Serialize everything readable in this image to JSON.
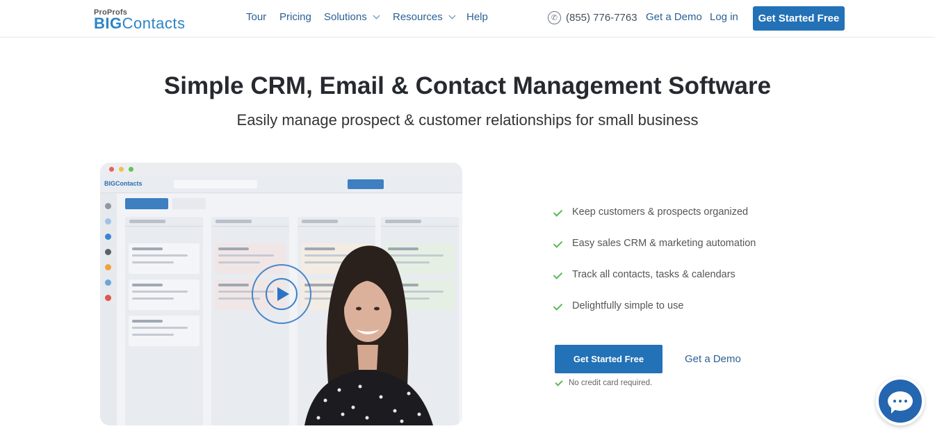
{
  "header": {
    "logo_top": "ProProfs",
    "logo_big": "BIG",
    "logo_rest": "Contacts",
    "nav": {
      "tour": "Tour",
      "pricing": "Pricing",
      "solutions": "Solutions",
      "resources": "Resources",
      "help": "Help"
    },
    "phone": "(855) 776-7763",
    "get_demo": "Get a Demo",
    "login": "Log in",
    "cta": "Get Started Free"
  },
  "hero": {
    "title": "Simple CRM, Email & Contact Management Software",
    "subtitle": "Easily manage prospect & customer relationships for small business"
  },
  "video": {
    "app_logo": "BIGContacts"
  },
  "features": [
    "Keep customers & prospects organized",
    "Easy sales CRM & marketing automation",
    "Track all contacts, tasks & calendars",
    "Delightfully simple to use"
  ],
  "cta": {
    "primary": "Get Started Free",
    "secondary": "Get a Demo",
    "note": "No credit card required."
  },
  "colors": {
    "brand_blue": "#2371b6",
    "link_blue": "#2a5f95",
    "check_green": "#5cb85c",
    "chat_blue": "#2466b0"
  },
  "icons": [
    "phone-icon",
    "chevron-down-icon",
    "play-icon",
    "check-icon",
    "chat-icon"
  ]
}
